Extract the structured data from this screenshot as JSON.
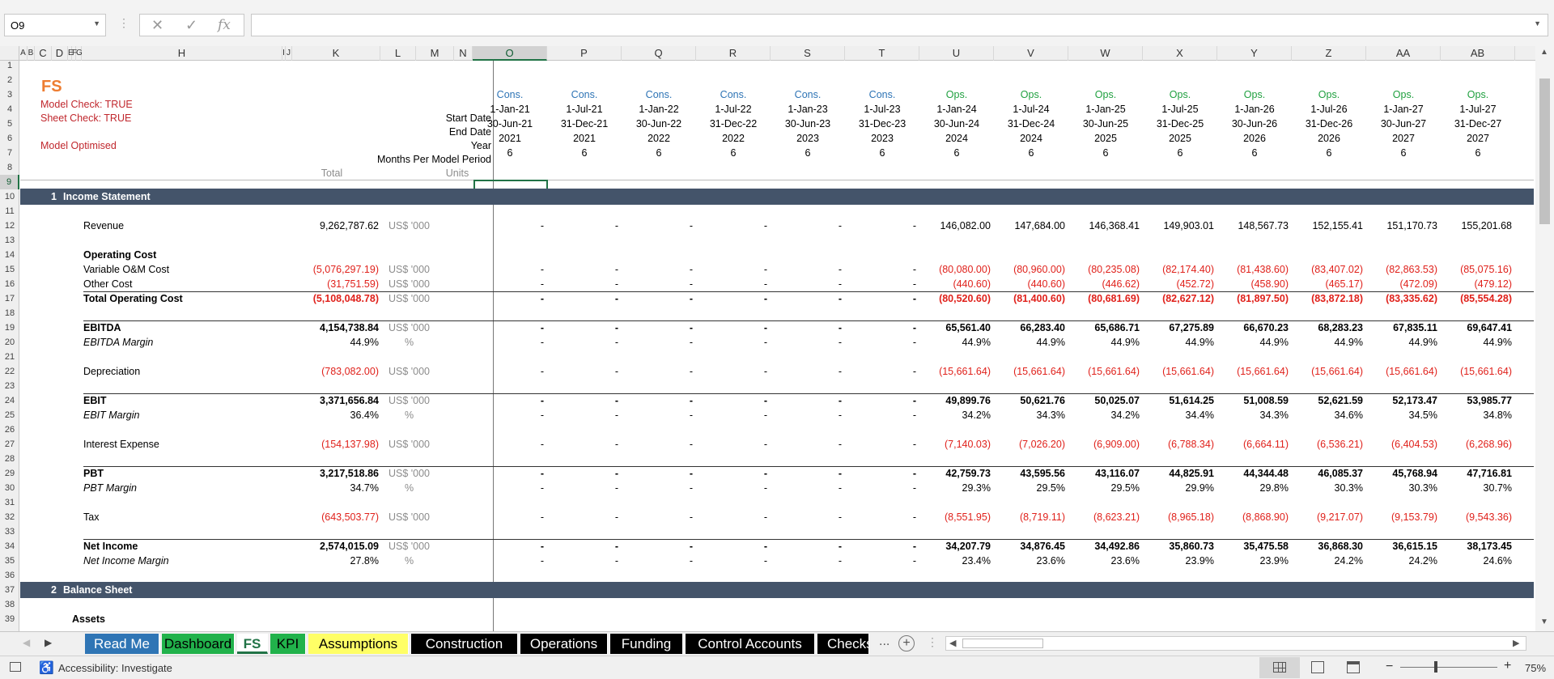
{
  "name_box": "O9",
  "formula": "",
  "icons": {
    "cancel": "✕",
    "enter": "✓",
    "fx": "fx"
  },
  "columns": [
    {
      "l": "A"
    },
    {
      "l": "B"
    },
    {
      "l": "C"
    },
    {
      "l": "D"
    },
    {
      "l": "E"
    },
    {
      "l": "F"
    },
    {
      "l": "G"
    },
    {
      "l": "H"
    },
    {
      "l": "I"
    },
    {
      "l": "J"
    },
    {
      "l": "K"
    },
    {
      "l": "L"
    },
    {
      "l": "M"
    },
    {
      "l": "N"
    },
    {
      "l": "O"
    },
    {
      "l": "P"
    },
    {
      "l": "Q"
    },
    {
      "l": "R"
    },
    {
      "l": "S"
    },
    {
      "l": "T"
    },
    {
      "l": "U"
    },
    {
      "l": "V"
    },
    {
      "l": "W"
    },
    {
      "l": "X"
    },
    {
      "l": "Y"
    },
    {
      "l": "Z"
    },
    {
      "l": "AA"
    },
    {
      "l": "AB"
    }
  ],
  "rows": [
    "1",
    "2",
    "3",
    "4",
    "5",
    "6",
    "7",
    "8",
    "9",
    "10",
    "11",
    "12",
    "13",
    "14",
    "15",
    "16",
    "17",
    "18",
    "19",
    "20",
    "21",
    "22",
    "23",
    "24",
    "25",
    "26",
    "27",
    "28",
    "29",
    "30",
    "31",
    "32",
    "33",
    "34",
    "35",
    "36",
    "37",
    "38",
    "39"
  ],
  "sheet": {
    "title": "FS",
    "model_check": "Model Check: TRUE",
    "sheet_check": "Sheet Check: TRUE",
    "model_optimised": "Model Optimised",
    "label_start": "Start Date",
    "label_end": "End Date",
    "label_year": "Year",
    "label_months": "Months Per Model Period",
    "label_total": "Total",
    "label_units": "Units"
  },
  "periods": {
    "type": [
      "Cons.",
      "Cons.",
      "Cons.",
      "Cons.",
      "Cons.",
      "Cons.",
      "Ops.",
      "Ops.",
      "Ops.",
      "Ops.",
      "Ops.",
      "Ops.",
      "Ops.",
      "Ops."
    ],
    "start": [
      "1-Jan-21",
      "1-Jul-21",
      "1-Jan-22",
      "1-Jul-22",
      "1-Jan-23",
      "1-Jul-23",
      "1-Jan-24",
      "1-Jul-24",
      "1-Jan-25",
      "1-Jul-25",
      "1-Jan-26",
      "1-Jul-26",
      "1-Jan-27",
      "1-Jul-27"
    ],
    "end": [
      "30-Jun-21",
      "31-Dec-21",
      "30-Jun-22",
      "31-Dec-22",
      "30-Jun-23",
      "31-Dec-23",
      "30-Jun-24",
      "31-Dec-24",
      "30-Jun-25",
      "31-Dec-25",
      "30-Jun-26",
      "31-Dec-26",
      "30-Jun-27",
      "31-Dec-27"
    ],
    "year": [
      "2021",
      "2021",
      "2022",
      "2022",
      "2023",
      "2023",
      "2024",
      "2024",
      "2025",
      "2025",
      "2026",
      "2026",
      "2027",
      "2027"
    ],
    "months": [
      "6",
      "6",
      "6",
      "6",
      "6",
      "6",
      "6",
      "6",
      "6",
      "6",
      "6",
      "6",
      "6",
      "6"
    ]
  },
  "sections": [
    {
      "num": "1",
      "title": "Income Statement"
    },
    {
      "num": "2",
      "title": "Balance Sheet"
    }
  ],
  "line_items": [
    {
      "label": "Revenue",
      "total": "9,262,787.62",
      "units": "US$ '000",
      "vals": [
        "-",
        "-",
        "-",
        "-",
        "-",
        "-",
        "146,082.00",
        "147,684.00",
        "146,368.41",
        "149,903.01",
        "148,567.73",
        "152,155.41",
        "151,170.73",
        "155,201.68"
      ]
    },
    {
      "label": "Operating Cost"
    },
    {
      "label": "Variable O&M Cost",
      "total": "(5,076,297.19)",
      "units": "US$ '000",
      "vals": [
        "-",
        "-",
        "-",
        "-",
        "-",
        "-",
        "(80,080.00)",
        "(80,960.00)",
        "(80,235.08)",
        "(82,174.40)",
        "(81,438.60)",
        "(83,407.02)",
        "(82,863.53)",
        "(85,075.16)"
      ]
    },
    {
      "label": "Other Cost",
      "total": "(31,751.59)",
      "units": "US$ '000",
      "vals": [
        "-",
        "-",
        "-",
        "-",
        "-",
        "-",
        "(440.60)",
        "(440.60)",
        "(446.62)",
        "(452.72)",
        "(458.90)",
        "(465.17)",
        "(472.09)",
        "(479.12)"
      ]
    },
    {
      "label": "Total Operating Cost",
      "total": "(5,108,048.78)",
      "units": "US$ '000",
      "vals": [
        "-",
        "-",
        "-",
        "-",
        "-",
        "-",
        "(80,520.60)",
        "(81,400.60)",
        "(80,681.69)",
        "(82,627.12)",
        "(81,897.50)",
        "(83,872.18)",
        "(83,335.62)",
        "(85,554.28)"
      ]
    },
    {
      "label": "EBITDA",
      "total": "4,154,738.84",
      "units": "US$ '000",
      "vals": [
        "-",
        "-",
        "-",
        "-",
        "-",
        "-",
        "65,561.40",
        "66,283.40",
        "65,686.71",
        "67,275.89",
        "66,670.23",
        "68,283.23",
        "67,835.11",
        "69,647.41"
      ]
    },
    {
      "label": "EBITDA Margin",
      "total": "44.9%",
      "units": "%",
      "vals": [
        "-",
        "-",
        "-",
        "-",
        "-",
        "-",
        "44.9%",
        "44.9%",
        "44.9%",
        "44.9%",
        "44.9%",
        "44.9%",
        "44.9%",
        "44.9%"
      ]
    },
    {
      "label": "Depreciation",
      "total": "(783,082.00)",
      "units": "US$ '000",
      "vals": [
        "-",
        "-",
        "-",
        "-",
        "-",
        "-",
        "(15,661.64)",
        "(15,661.64)",
        "(15,661.64)",
        "(15,661.64)",
        "(15,661.64)",
        "(15,661.64)",
        "(15,661.64)",
        "(15,661.64)"
      ]
    },
    {
      "label": "EBIT",
      "total": "3,371,656.84",
      "units": "US$ '000",
      "vals": [
        "-",
        "-",
        "-",
        "-",
        "-",
        "-",
        "49,899.76",
        "50,621.76",
        "50,025.07",
        "51,614.25",
        "51,008.59",
        "52,621.59",
        "52,173.47",
        "53,985.77"
      ]
    },
    {
      "label": "EBIT Margin",
      "total": "36.4%",
      "units": "%",
      "vals": [
        "-",
        "-",
        "-",
        "-",
        "-",
        "-",
        "34.2%",
        "34.3%",
        "34.2%",
        "34.4%",
        "34.3%",
        "34.6%",
        "34.5%",
        "34.8%"
      ]
    },
    {
      "label": "Interest Expense",
      "total": "(154,137.98)",
      "units": "US$ '000",
      "vals": [
        "-",
        "-",
        "-",
        "-",
        "-",
        "-",
        "(7,140.03)",
        "(7,026.20)",
        "(6,909.00)",
        "(6,788.34)",
        "(6,664.11)",
        "(6,536.21)",
        "(6,404.53)",
        "(6,268.96)"
      ]
    },
    {
      "label": "PBT",
      "total": "3,217,518.86",
      "units": "US$ '000",
      "vals": [
        "-",
        "-",
        "-",
        "-",
        "-",
        "-",
        "42,759.73",
        "43,595.56",
        "43,116.07",
        "44,825.91",
        "44,344.48",
        "46,085.37",
        "45,768.94",
        "47,716.81"
      ]
    },
    {
      "label": "PBT Margin",
      "total": "34.7%",
      "units": "%",
      "vals": [
        "-",
        "-",
        "-",
        "-",
        "-",
        "-",
        "29.3%",
        "29.5%",
        "29.5%",
        "29.9%",
        "29.8%",
        "30.3%",
        "30.3%",
        "30.7%"
      ]
    },
    {
      "label": "Tax",
      "total": "(643,503.77)",
      "units": "US$ '000",
      "vals": [
        "-",
        "-",
        "-",
        "-",
        "-",
        "-",
        "(8,551.95)",
        "(8,719.11)",
        "(8,623.21)",
        "(8,965.18)",
        "(8,868.90)",
        "(9,217.07)",
        "(9,153.79)",
        "(9,543.36)"
      ]
    },
    {
      "label": "Net Income",
      "total": "2,574,015.09",
      "units": "US$ '000",
      "vals": [
        "-",
        "-",
        "-",
        "-",
        "-",
        "-",
        "34,207.79",
        "34,876.45",
        "34,492.86",
        "35,860.73",
        "35,475.58",
        "36,868.30",
        "36,615.15",
        "38,173.45"
      ]
    },
    {
      "label": "Net Income Margin",
      "total": "27.8%",
      "units": "%",
      "vals": [
        "-",
        "-",
        "-",
        "-",
        "-",
        "-",
        "23.4%",
        "23.6%",
        "23.6%",
        "23.9%",
        "23.9%",
        "24.2%",
        "24.2%",
        "24.6%"
      ]
    },
    {
      "label": "Assets"
    }
  ],
  "tabs": [
    {
      "label": "Read Me",
      "bg": "#2f75b5",
      "fg": "#ffffff"
    },
    {
      "label": "Dashboard",
      "bg": "#21b24b",
      "fg": "#000000"
    },
    {
      "label": "FS",
      "bg": "#ffffff",
      "fg": "#217346",
      "active": true
    },
    {
      "label": "KPI",
      "bg": "#21b24b",
      "fg": "#000000"
    },
    {
      "label": "Assumptions",
      "bg": "#ffff66",
      "fg": "#000000"
    },
    {
      "label": "Construction",
      "bg": "#000000",
      "fg": "#ffffff"
    },
    {
      "label": "Operations",
      "bg": "#000000",
      "fg": "#ffffff"
    },
    {
      "label": "Funding",
      "bg": "#000000",
      "fg": "#ffffff"
    },
    {
      "label": "Control Accounts",
      "bg": "#000000",
      "fg": "#ffffff"
    },
    {
      "label": "Checks",
      "bg": "#000000",
      "fg": "#ffffff"
    }
  ],
  "tab_more": "...",
  "tab_add": "+",
  "status": {
    "accessibility": "Accessibility: Investigate",
    "zoom": "75%",
    "minus": "−",
    "plus": "+"
  },
  "colors": {
    "band": "#44546a",
    "negative": "#e0211b",
    "cons": "#2e74b5",
    "ops": "#20a040",
    "check": "#c0272d",
    "title": "#ed7d31"
  }
}
